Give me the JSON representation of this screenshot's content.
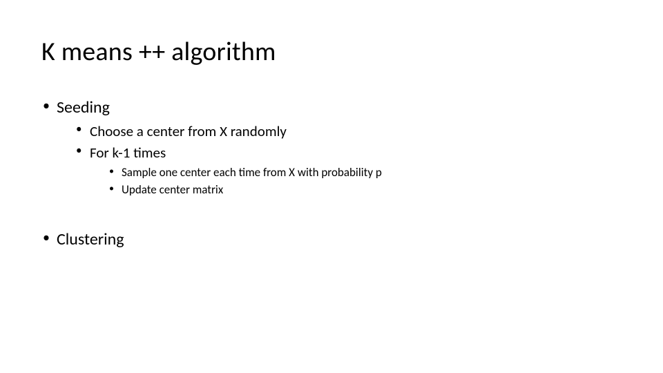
{
  "title": "K means ++ algorithm",
  "bullets": {
    "seeding": "Seeding",
    "seeding_sub": {
      "choose": "Choose a center from X randomly",
      "fork": "For k-1 times",
      "fork_sub": {
        "sample": "Sample one center each time from X with probability p",
        "update": "Update center matrix"
      }
    },
    "clustering": "Clustering"
  }
}
